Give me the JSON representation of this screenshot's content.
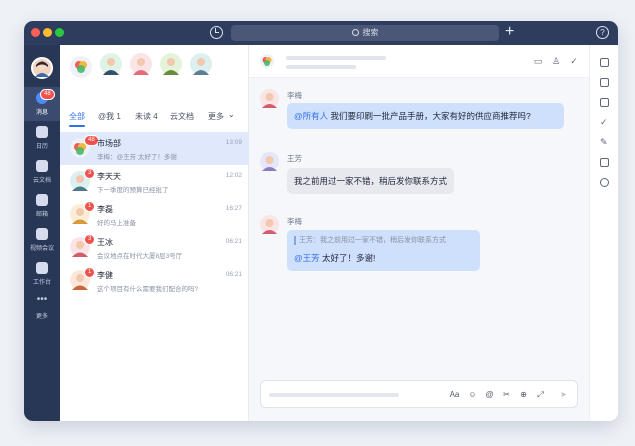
{
  "app": {
    "search_label": "搜索",
    "plus": "+",
    "help": "?"
  },
  "rail": {
    "badge": "48",
    "items": [
      {
        "label": "消息"
      },
      {
        "label": "日历"
      },
      {
        "label": "云文档"
      },
      {
        "label": "邮箱"
      },
      {
        "label": "视频会议"
      },
      {
        "label": "工作台"
      },
      {
        "label": "更多"
      }
    ]
  },
  "tabs": [
    {
      "label": "全部"
    },
    {
      "label": "@我 1"
    },
    {
      "label": "未读 4"
    },
    {
      "label": "云文档"
    },
    {
      "label": "更多"
    }
  ],
  "conversations": [
    {
      "name": "市场部",
      "preview": "李梅：@王芳 太好了！多谢",
      "time": "13:09",
      "badge": "48"
    },
    {
      "name": "李天天",
      "preview": "下一季度的预算已经批了",
      "time": "12:02",
      "badge": "3"
    },
    {
      "name": "李磊",
      "preview": "好的马上准备",
      "time": "16:27",
      "badge": "1"
    },
    {
      "name": "王冰",
      "preview": "会议地点在时代大厦8层3号厅",
      "time": "06:21",
      "badge": "3"
    },
    {
      "name": "李健",
      "preview": "这个项目有什么需要我们配合的吗?",
      "time": "06:21",
      "badge": "1"
    }
  ],
  "messages": [
    {
      "sender": "李梅",
      "mention": "@所有人",
      "text": "我们要印刷一批产品手册，大家有好的供应商推荐吗?"
    },
    {
      "sender": "王芳",
      "text": "我之前用过一家不错，稍后发你联系方式"
    },
    {
      "sender": "李梅",
      "quote": "王芳：我之前用过一家不错，稍后发你联系方式",
      "mention": "@王芳",
      "text": "太好了！多谢!"
    }
  ],
  "colors": {
    "accent": "#3370e8",
    "rail": "#283756",
    "badge": "#f0524e"
  }
}
